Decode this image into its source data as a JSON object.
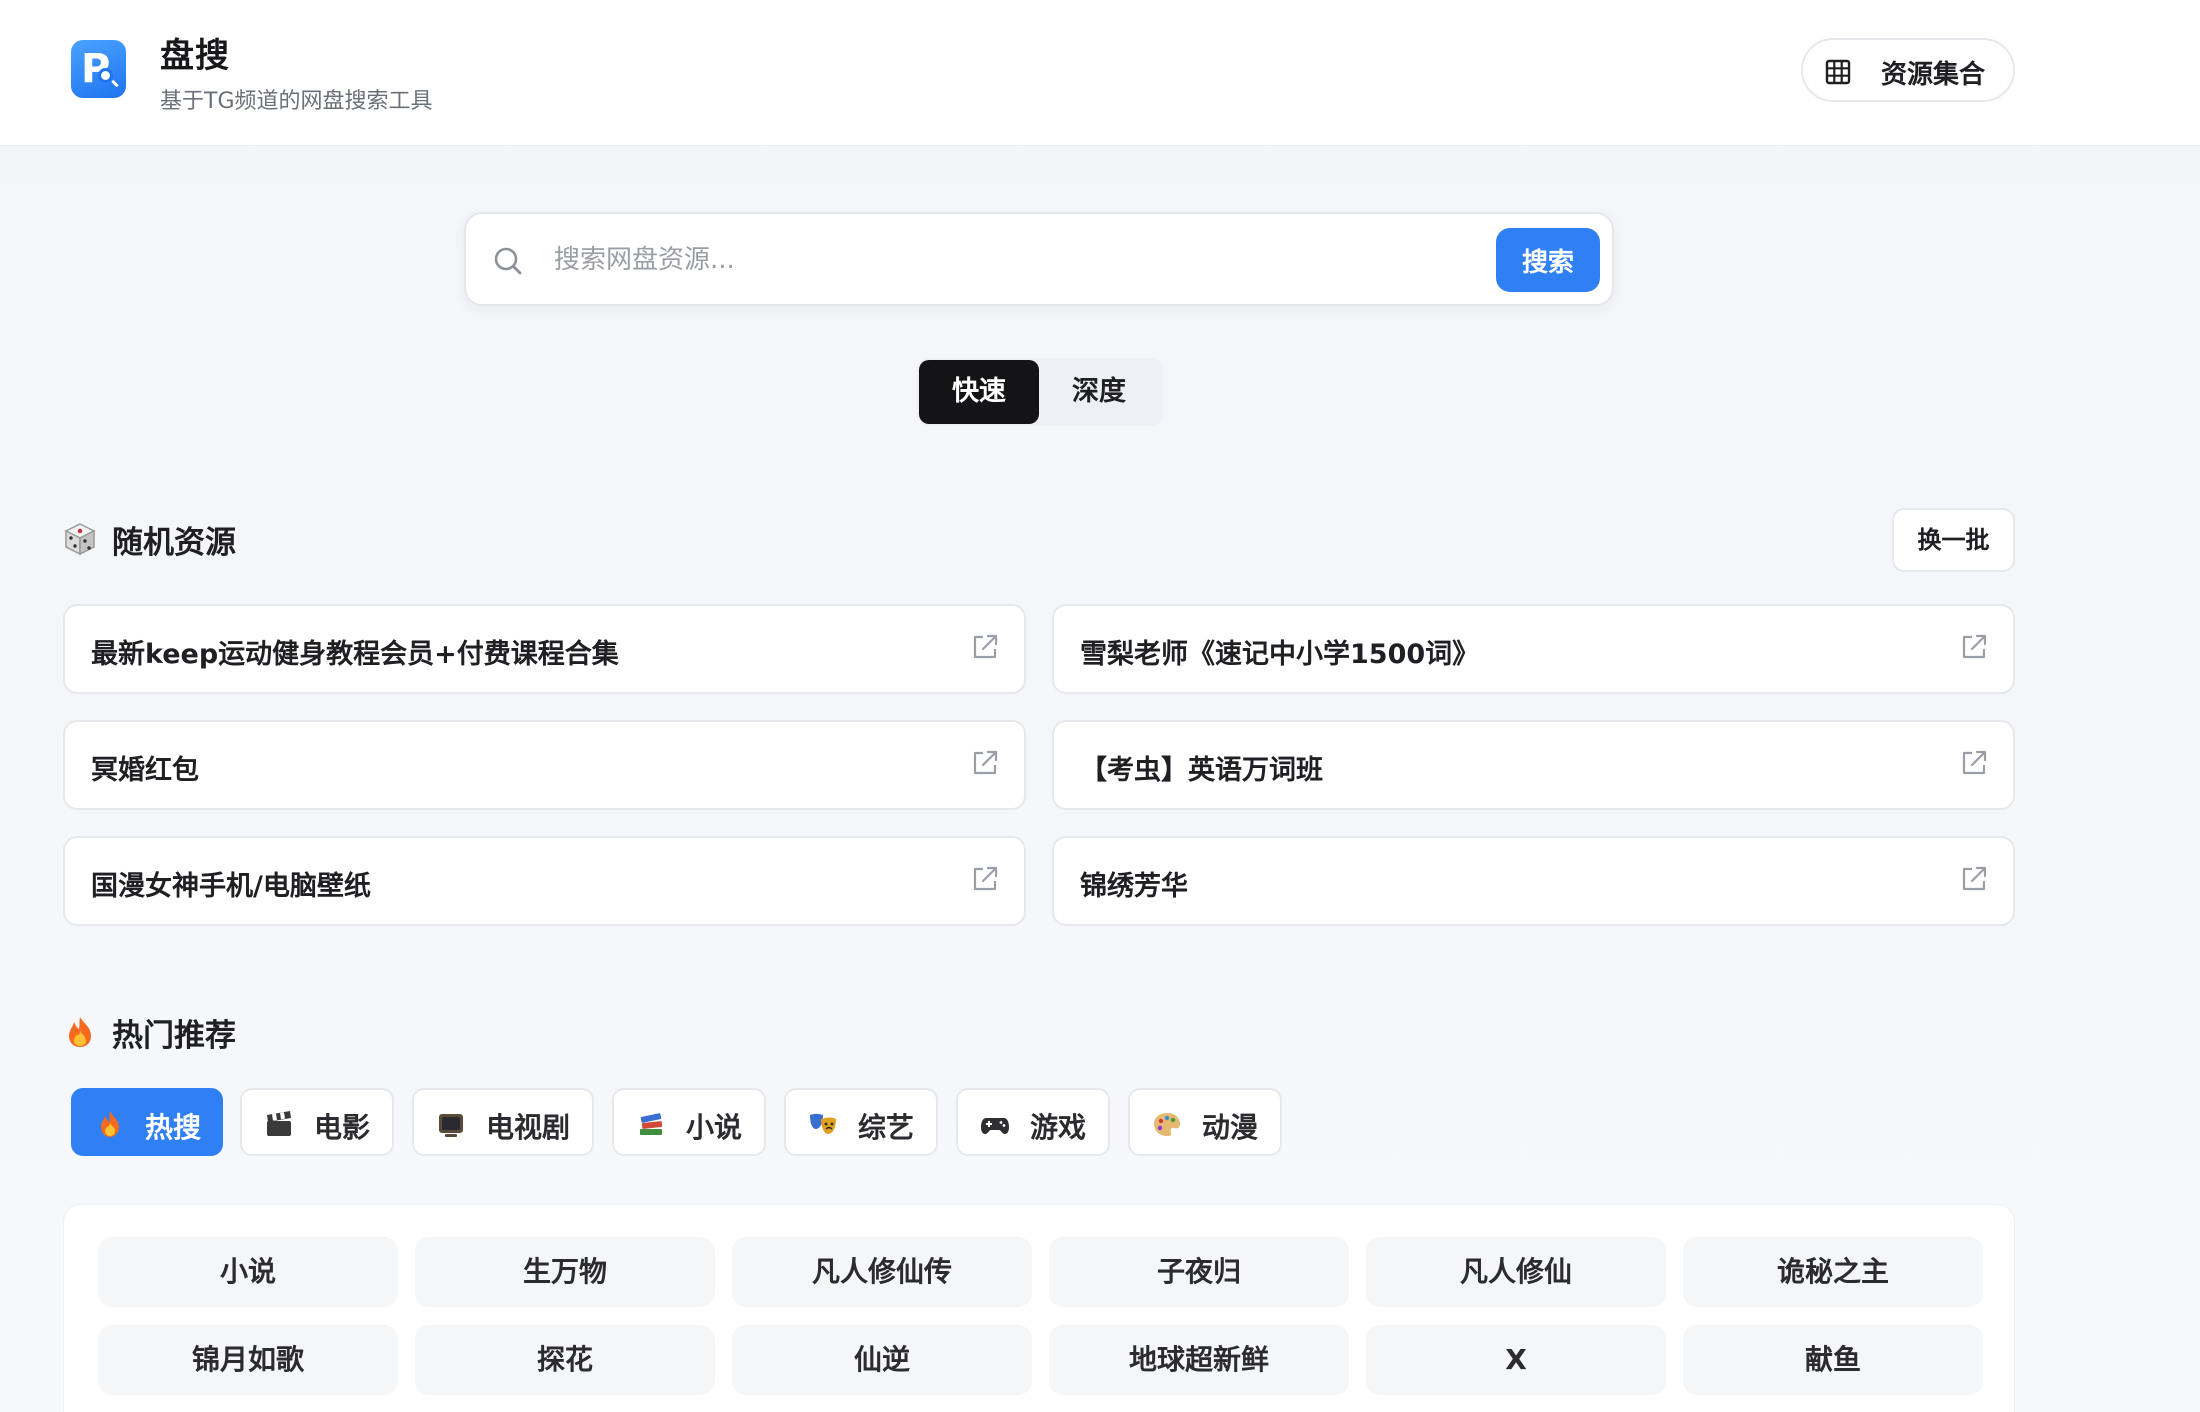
{
  "header": {
    "title": "盘搜",
    "subtitle": "基于TG频道的网盘搜索工具",
    "collection_label": "资源集合"
  },
  "search": {
    "placeholder": "搜索网盘资源...",
    "button_label": "搜索"
  },
  "modes": {
    "fast": "快速",
    "deep": "深度",
    "active": "fast"
  },
  "random_section": {
    "title": "随机资源",
    "emoji": "dice-icon",
    "refresh_label": "换一批",
    "items": [
      "最新keep运动健身教程会员+付费课程合集",
      "雪梨老师《速记中小学1500词》",
      "冥婚红包",
      "【考虫】英语万词班",
      "国漫女神手机/电脑壁纸",
      "锦绣芳华"
    ]
  },
  "hot_section": {
    "title": "热门推荐",
    "emoji": "fire-icon",
    "tabs": [
      {
        "label": "热搜",
        "icon": "fire-icon",
        "active": true
      },
      {
        "label": "电影",
        "icon": "clapper-icon",
        "active": false
      },
      {
        "label": "电视剧",
        "icon": "tv-icon",
        "active": false
      },
      {
        "label": "小说",
        "icon": "books-icon",
        "active": false
      },
      {
        "label": "综艺",
        "icon": "masks-icon",
        "active": false
      },
      {
        "label": "游戏",
        "icon": "gamepad-icon",
        "active": false
      },
      {
        "label": "动漫",
        "icon": "palette-icon",
        "active": false
      }
    ],
    "items": [
      "小说",
      "生万物",
      "凡人修仙传",
      "子夜归",
      "凡人修仙",
      "诡秘之主",
      "锦月如歌",
      "探花",
      "仙逆",
      "地球超新鲜",
      "X",
      "献鱼"
    ]
  },
  "colors": {
    "accent": "#2f7ff5",
    "dark": "#141416",
    "background": "#f4f6fa"
  }
}
